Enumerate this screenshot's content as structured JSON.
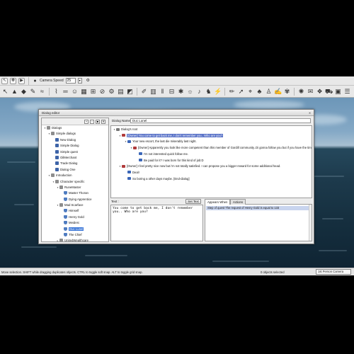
{
  "toolbar": {
    "camera_speed_label": "Camera Speed",
    "camera_speed_value": "25",
    "row1_icons": [
      "select-icon",
      "move-icon",
      "play-icon",
      "camera-icon"
    ],
    "row2_icons": [
      "cursor-icon",
      "terrain-icon",
      "place-icon",
      "paint-icon",
      "water-icon",
      "path-icon",
      "road-icon",
      "npc-icon",
      "wall-icon",
      "group-icon",
      "circle-icon",
      "gear-icon",
      "texture-icon",
      "region-icon",
      "brush-icon",
      "grid-icon",
      "levels-icon",
      "barrier-icon",
      "sun-icon",
      "light-icon",
      "sound-icon",
      "creature-icon",
      "trigger-icon",
      "pencil-icon",
      "arrow-icon",
      "waypoint-icon",
      "tree-icon",
      "person-icon",
      "edit-icon",
      "palm-icon",
      "spawn-icon",
      "chat-icon",
      "quest-icon",
      "cart-icon",
      "book-icon",
      "dialog-icon",
      "flag-icon",
      "export-icon"
    ]
  },
  "dialog_window": {
    "title": "Dialog editor",
    "tree": {
      "items": [
        {
          "label": "Dialogs",
          "level": 0,
          "icon": "folder",
          "arrow": "▾"
        },
        {
          "label": "Simple dialogs",
          "level": 1,
          "icon": "folder",
          "arrow": "▾"
        },
        {
          "label": "New Dialog",
          "level": 2,
          "icon": "file",
          "arrow": ""
        },
        {
          "label": "Simple Dialog",
          "level": 2,
          "icon": "file",
          "arrow": ""
        },
        {
          "label": "Simple quest",
          "level": 2,
          "icon": "file",
          "arrow": ""
        },
        {
          "label": "OilMerchant",
          "level": 2,
          "icon": "file",
          "arrow": ""
        },
        {
          "label": "Trade Dialog",
          "level": 2,
          "icon": "file",
          "arrow": ""
        },
        {
          "label": "Dialog One",
          "level": 2,
          "icon": "file",
          "arrow": ""
        },
        {
          "label": "Introduction",
          "level": 1,
          "icon": "folder",
          "arrow": "▾"
        },
        {
          "label": "Character specific",
          "level": 2,
          "icon": "folder",
          "arrow": "▾"
        },
        {
          "label": "RuneMaster",
          "level": 3,
          "icon": "folder",
          "arrow": "▾"
        },
        {
          "label": "Master Thoran",
          "level": 4,
          "icon": "npc",
          "arrow": ""
        },
        {
          "label": "Dying Apprentice",
          "level": 4,
          "icon": "npc",
          "arrow": ""
        },
        {
          "label": "Mad Scarface",
          "level": 3,
          "icon": "folder",
          "arrow": "▾"
        },
        {
          "label": "Himself",
          "level": 4,
          "icon": "npc",
          "arrow": ""
        },
        {
          "label": "Henry Gold",
          "level": 4,
          "icon": "npc",
          "arrow": ""
        },
        {
          "label": "Meiderc",
          "level": 4,
          "icon": "npc",
          "arrow": ""
        },
        {
          "label": "Duc Lunel",
          "level": 4,
          "icon": "npc",
          "arrow": "",
          "selected": true
        },
        {
          "label": "The Chief",
          "level": 4,
          "icon": "npc",
          "arrow": ""
        },
        {
          "label": "UnitedWealthcare",
          "level": 3,
          "icon": "folder",
          "arrow": "▸"
        }
      ]
    },
    "dialog_name_label": "Dialog Name:",
    "dialog_name_value": "Duc Lunel",
    "nodes": [
      {
        "label": "Dialog's root",
        "level": 0,
        "icon": "root",
        "arrow": "▾"
      },
      {
        "label": "[Owner] You come to get back me, I don't remember you.. Who are you?",
        "level": 1,
        "icon": "npc",
        "arrow": "▾",
        "selected": true
      },
      {
        "label": "Your new escort, the last die miserably last night.",
        "level": 2,
        "icon": "player",
        "arrow": "▾"
      },
      {
        "label": "[Owner] Apparently you look like more competent than this member of Gordill community..Di gonna follow you but if you have the time",
        "level": 3,
        "icon": "npc",
        "arrow": "▾"
      },
      {
        "label": "I'm not interested quick follow me.",
        "level": 4,
        "icon": "player",
        "arrow": ""
      },
      {
        "label": "Be paid for it? I was born for this kind of job:D",
        "level": 4,
        "icon": "player",
        "arrow": ""
      },
      {
        "label": "[Owner] I feel pretty nice now but i'm not totally satisfied. I can propose you a bigger reward for some additional head.",
        "level": 1,
        "icon": "npc",
        "arrow": "▾"
      },
      {
        "label": "Deal!",
        "level": 2,
        "icon": "player",
        "arrow": ""
      },
      {
        "label": "So boring a other days maybe. [End-dialog]",
        "level": 2,
        "icon": "player",
        "arrow": ""
      }
    ],
    "text_label": "Text :",
    "set_text_button": "Set Text",
    "text_value": "You come to get back me, I don't remember you.. Who are you?",
    "tabs": [
      {
        "label": "Appears When",
        "active": true
      },
      {
        "label": "Actions",
        "active": false
      }
    ],
    "condition": "Step of quest The request of Henry Gold is equal to 133"
  },
  "statusbar": {
    "text": "Move selection. SHIFT while dragging duplicates objects. CTRL to toggle soft snap. ALT to toggle grid snap.",
    "selected_count": "0 objects selected",
    "camera_mode": "1st Person Camera"
  },
  "colors": {
    "selection": "#3875d7",
    "node_selection": "#5a73c8",
    "npc_line": "#b03a3a",
    "player_line": "#3a66b8",
    "sea": "#1d3a4c",
    "sky": "#85a9c6"
  }
}
